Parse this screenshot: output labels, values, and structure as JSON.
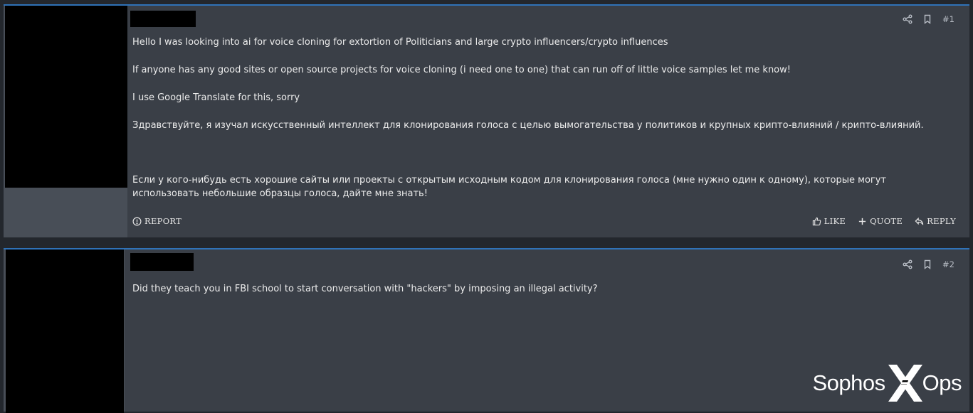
{
  "posts": [
    {
      "number": "#1",
      "paragraphs": [
        "Hello I was looking into ai for voice cloning for extortion of Politicians and large crypto influencers/crypto influences",
        "If anyone has any good sites or open source projects for voice cloning (i need one to one) that can run off of little voice samples let me know!",
        "I use Google Translate for this, sorry",
        "Здравствуйте, я изучал искусственный интеллект для клонирования голоса с целью вымогательства у политиков и крупных крипто-влияний / крипто-влияний.",
        "Если у кого-нибудь есть хорошие сайты или проекты с открытым исходным кодом для клонирования голоса (мне нужно один к одному), которые могут использовать небольшие образцы голоса, дайте мне знать!"
      ],
      "actions": {
        "report": "REPORT",
        "like": "LIKE",
        "quote": "QUOTE",
        "reply": "REPLY"
      }
    },
    {
      "number": "#2",
      "paragraphs": [
        "Did they teach you in FBI school to start conversation with \"hackers\" by imposing an illegal activity?"
      ]
    }
  ],
  "watermark": {
    "left": "Sophos",
    "right": "Ops"
  },
  "icons": {
    "share": "share-icon",
    "bookmark": "bookmark-icon",
    "report": "alert-circle-icon",
    "like": "thumbs-up-icon",
    "quote": "plus-icon",
    "reply": "reply-icon"
  },
  "colors": {
    "page_bg": "#23272d",
    "post_bg": "#3a3f47",
    "user_col_bg": "#484e57",
    "accent_border": "#2f72b8",
    "redaction": "#000000"
  }
}
